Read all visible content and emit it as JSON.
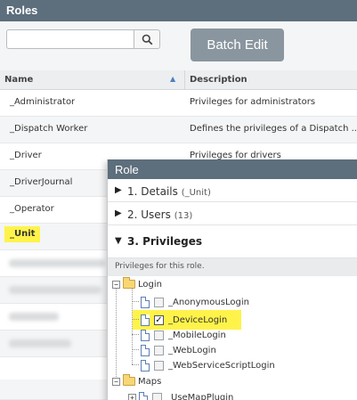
{
  "header": {
    "title": "Roles"
  },
  "toolbar": {
    "search_value": "",
    "search_placeholder": "",
    "batch_edit_label": "Batch Edit"
  },
  "grid": {
    "columns": {
      "name": "Name",
      "description": "Description"
    },
    "rows": [
      {
        "name": "_Administrator",
        "description": "Privileges for administrators"
      },
      {
        "name": "_Dispatch Worker",
        "description": "Defines the privileges of a Dispatch ..."
      },
      {
        "name": "_Driver",
        "description": "Privileges for drivers"
      },
      {
        "name": "_DriverJournal",
        "description": ""
      },
      {
        "name": "_Operator",
        "description": ""
      },
      {
        "name": "_Unit",
        "description": ""
      }
    ]
  },
  "role_panel": {
    "title": "Role",
    "sections": [
      {
        "label": "1. Details",
        "count": "(_Unit)"
      },
      {
        "label": "2. Users",
        "count": "(13)"
      },
      {
        "label": "3. Privileges",
        "count": ""
      }
    ],
    "privileges_note": "Privileges for this role.",
    "tree": {
      "login_folder": "Login",
      "login_items": [
        {
          "label": "_AnonymousLogin",
          "checked": false
        },
        {
          "label": "_DeviceLogin",
          "checked": true
        },
        {
          "label": "_MobileLogin",
          "checked": false
        },
        {
          "label": "_WebLogin",
          "checked": false
        },
        {
          "label": "_WebServiceScriptLogin",
          "checked": false
        }
      ],
      "maps_folder": "Maps",
      "maps_items": [
        {
          "label": "_UseMapPlugin",
          "checked": false
        }
      ]
    }
  },
  "colors": {
    "header_bg": "#5d6e7c",
    "highlight": "#fff34a",
    "button_bg": "#8a969f"
  }
}
